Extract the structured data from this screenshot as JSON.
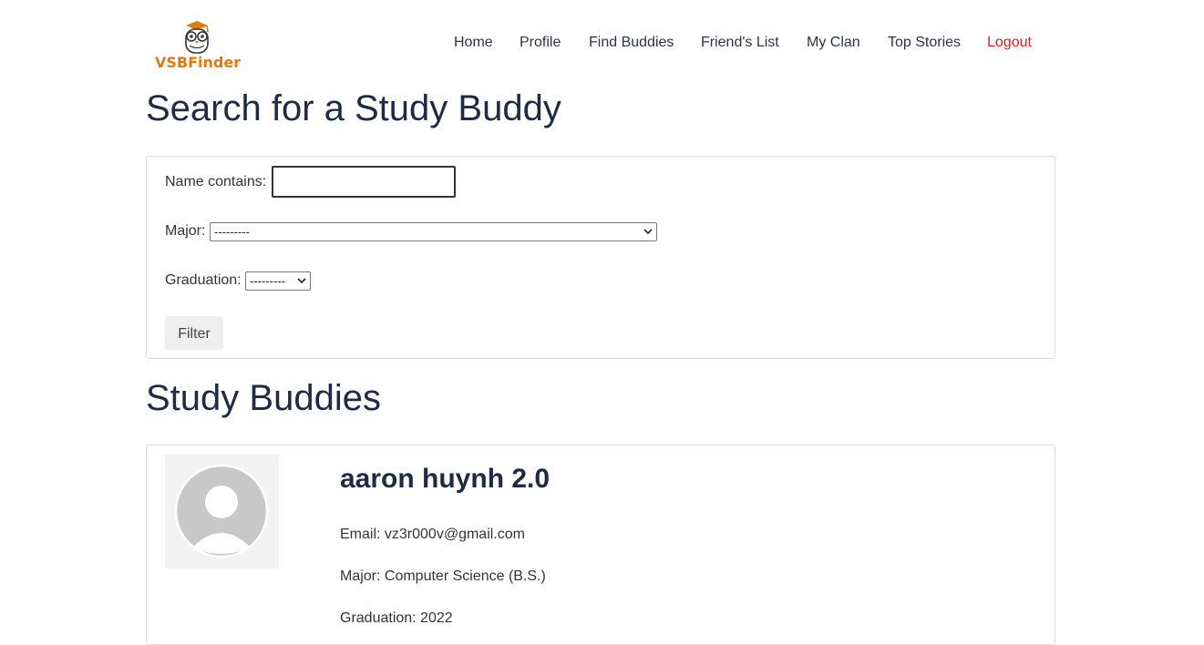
{
  "brand": {
    "name": "VSBFinder",
    "logo_icon": "owl-graduation-icon",
    "color": "#e07b10"
  },
  "nav": {
    "home": "Home",
    "profile": "Profile",
    "find_buddies": "Find Buddies",
    "friends_list": "Friend's List",
    "my_clan": "My Clan",
    "top_stories": "Top Stories",
    "logout": "Logout"
  },
  "page_title": "Search for a Study Buddy",
  "filter": {
    "name_label": "Name contains:",
    "name_value": "",
    "major_label": "Major:",
    "major_selected": "---------",
    "graduation_label": "Graduation:",
    "graduation_selected": "---------",
    "filter_button": "Filter"
  },
  "results_title": "Study Buddies",
  "buddies": [
    {
      "name": "aaron huynh 2.0",
      "email": "Email: vz3r000v@gmail.com",
      "major": "Major: Computer Science (B.S.)",
      "graduation": "Graduation: 2022",
      "avatar_icon": "default-avatar-icon"
    }
  ],
  "colors": {
    "logout": "#e31b1b",
    "heading": "#1f2a44"
  }
}
